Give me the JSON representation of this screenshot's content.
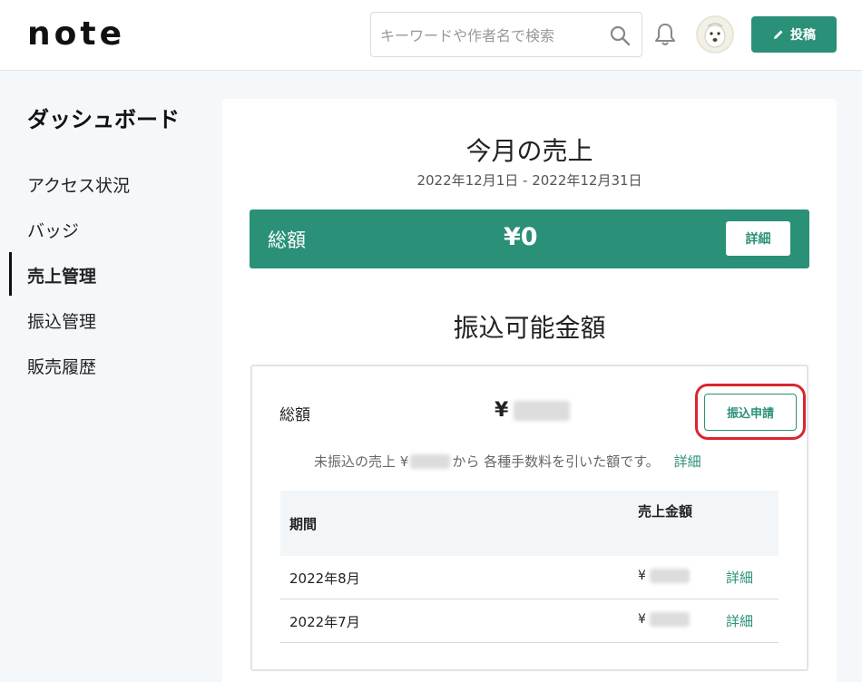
{
  "header": {
    "logo": "note",
    "search_placeholder": "キーワードや作者名で検索",
    "post_label": "投稿"
  },
  "sidebar": {
    "title": "ダッシュボード",
    "items": [
      {
        "label": "アクセス状況",
        "active": false
      },
      {
        "label": "バッジ",
        "active": false
      },
      {
        "label": "売上管理",
        "active": true
      },
      {
        "label": "振込管理",
        "active": false
      },
      {
        "label": "販売履歴",
        "active": false
      }
    ]
  },
  "monthly": {
    "title": "今月の売上",
    "date_range": "2022年12月1日 - 2022年12月31日",
    "total_label": "総額",
    "total_value": "¥0",
    "detail_label": "詳細"
  },
  "transfer": {
    "title": "振込可能金額",
    "total_label": "総額",
    "currency": "¥",
    "apply_label": "振込申請",
    "note_prefix": "未振込の売上 ¥",
    "note_suffix": "から 各種手数料を引いた額です。",
    "note_detail": "詳細",
    "table": {
      "headers": {
        "period": "期間",
        "amount": "売上金額"
      },
      "rows": [
        {
          "period": "2022年8月",
          "currency": "¥",
          "detail": "詳細"
        },
        {
          "period": "2022年7月",
          "currency": "¥",
          "detail": "詳細"
        }
      ]
    }
  },
  "colors": {
    "accent": "#2a9078",
    "highlight": "#d9262f"
  }
}
